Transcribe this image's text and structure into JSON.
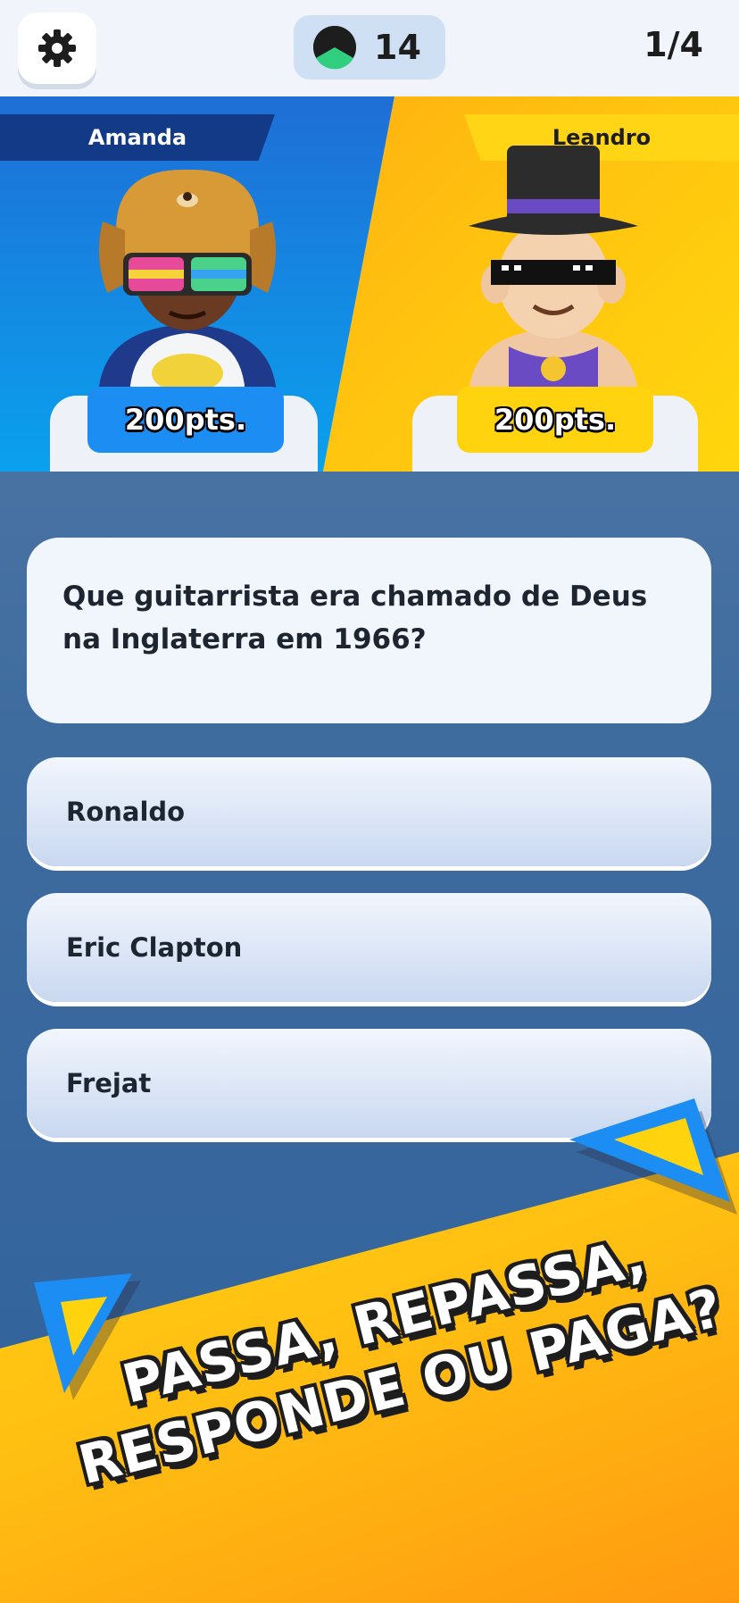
{
  "header": {
    "settings_icon": "gear-icon",
    "timer_icon": "pie-timer-icon",
    "timer_value": "14",
    "round": "1/4"
  },
  "players": [
    {
      "name": "Amanda",
      "points": "200pts.",
      "color": "#1c8df2"
    },
    {
      "name": "Leandro",
      "points": "200pts.",
      "color": "#ffd40f"
    }
  ],
  "question": {
    "text": "Que guitarrista era chamado de Deus na Inglaterra em 1966?"
  },
  "answers": [
    {
      "label": "Ronaldo"
    },
    {
      "label": "Eric Clapton"
    },
    {
      "label": "Frejat"
    }
  ],
  "promo": {
    "line1": "PASSA, REPASSA,",
    "line2": "RESPONDE OU PAGA?"
  }
}
